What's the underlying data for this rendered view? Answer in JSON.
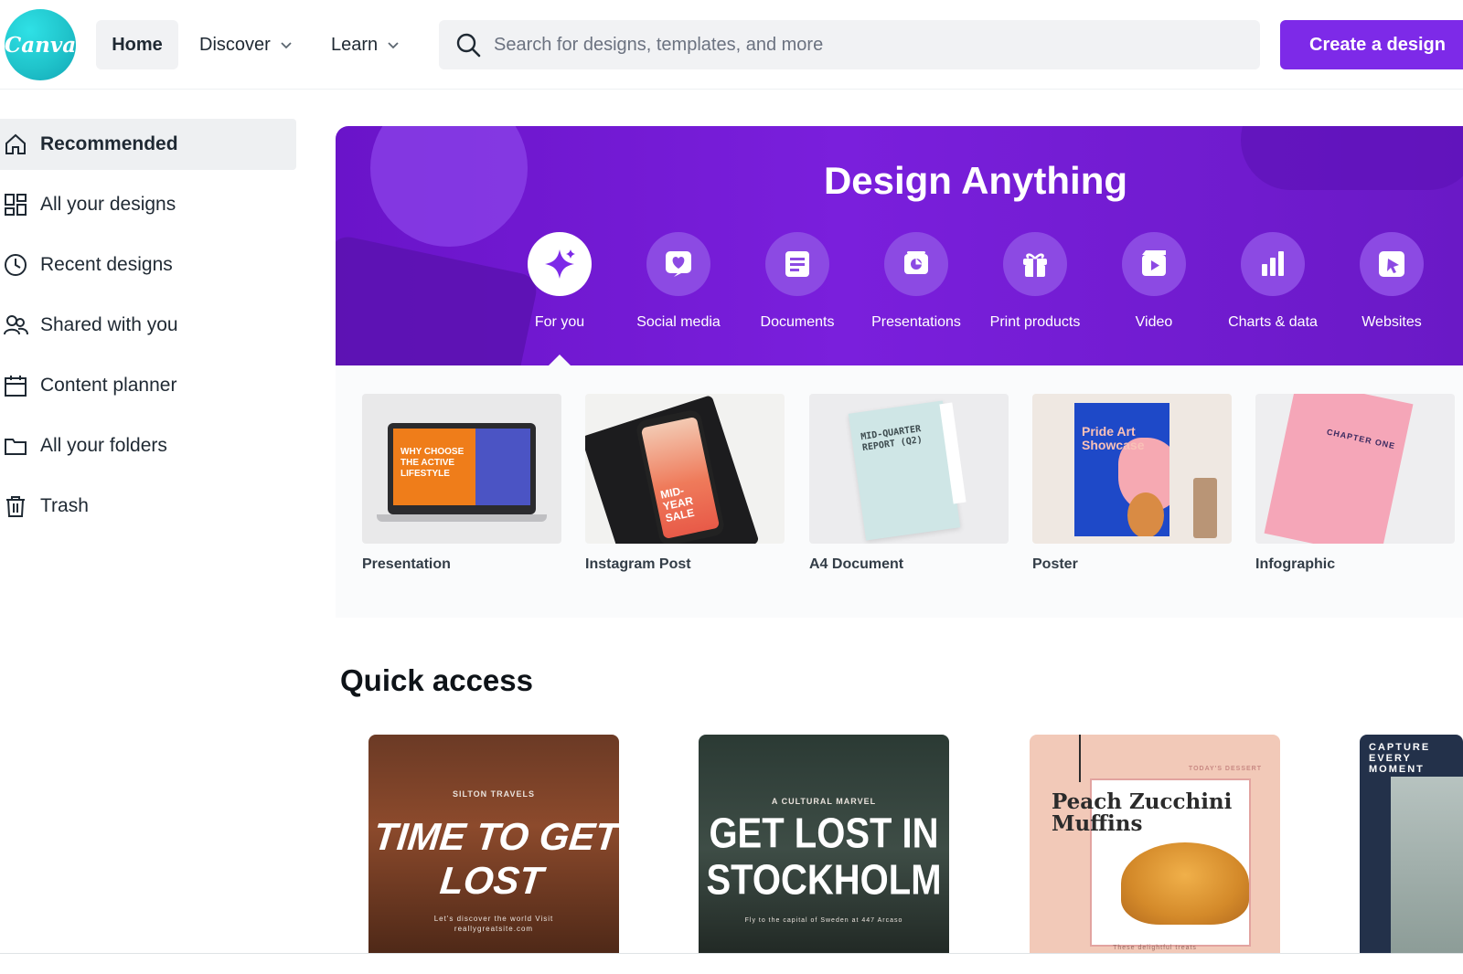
{
  "brand": {
    "logo_text": "Canva",
    "accent": "#7d2ae8",
    "logo_color": "#20c4cb"
  },
  "topbar": {
    "home": "Home",
    "discover": "Discover",
    "learn": "Learn",
    "search_placeholder": "Search for designs, templates, and more",
    "create": "Create a design"
  },
  "sidebar": {
    "items": [
      {
        "label": "Recommended",
        "icon": "home-icon",
        "active": true
      },
      {
        "label": "All your designs",
        "icon": "grid-icon"
      },
      {
        "label": "Recent designs",
        "icon": "clock-icon"
      },
      {
        "label": "Shared with you",
        "icon": "people-icon"
      },
      {
        "label": "Content planner",
        "icon": "calendar-icon"
      },
      {
        "label": "All your folders",
        "icon": "folder-icon"
      },
      {
        "label": "Trash",
        "icon": "trash-icon"
      }
    ]
  },
  "hero": {
    "title": "Design Anything",
    "background": "#7a1fdc",
    "categories": [
      {
        "label": "For you",
        "icon": "sparkle-icon",
        "active": true
      },
      {
        "label": "Social media",
        "icon": "heart-icon"
      },
      {
        "label": "Documents",
        "icon": "document-icon"
      },
      {
        "label": "Presentations",
        "icon": "presentation-icon"
      },
      {
        "label": "Print products",
        "icon": "gift-icon"
      },
      {
        "label": "Video",
        "icon": "video-icon"
      },
      {
        "label": "Charts & data",
        "icon": "bar-chart-icon"
      },
      {
        "label": "Websites",
        "icon": "cursor-icon"
      }
    ]
  },
  "templates": [
    {
      "label": "Presentation",
      "thumb_text": "WHY CHOOSE THE ACTIVE LIFESTYLE"
    },
    {
      "label": "Instagram Post",
      "thumb_text": "MID-YEAR SALE"
    },
    {
      "label": "A4 Document",
      "thumb_text": "MID-QUARTER REPORT (Q2)"
    },
    {
      "label": "Poster",
      "thumb_text": "Pride Art Showcase"
    },
    {
      "label": "Infographic",
      "thumb_text": "CHAPTER ONE"
    }
  ],
  "quick_access": {
    "title": "Quick access",
    "cards": [
      {
        "kicker": "SILTON TRAVELS",
        "title": "TIME TO GET LOST",
        "footer": "Let's discover the world Visit reallygreatsite.com"
      },
      {
        "kicker": "A CULTURAL MARVEL",
        "title": "GET LOST IN STOCKHOLM",
        "footer": "Fly to the capital of Sweden at 447 Arcaso"
      },
      {
        "kicker": "TODAY'S DESSERT",
        "title": "Peach Zucchini Muffins",
        "footer": "These delightful treats"
      },
      {
        "kicker": "",
        "title": "CAPTURE EVERY MOMENT",
        "footer": ""
      }
    ]
  }
}
